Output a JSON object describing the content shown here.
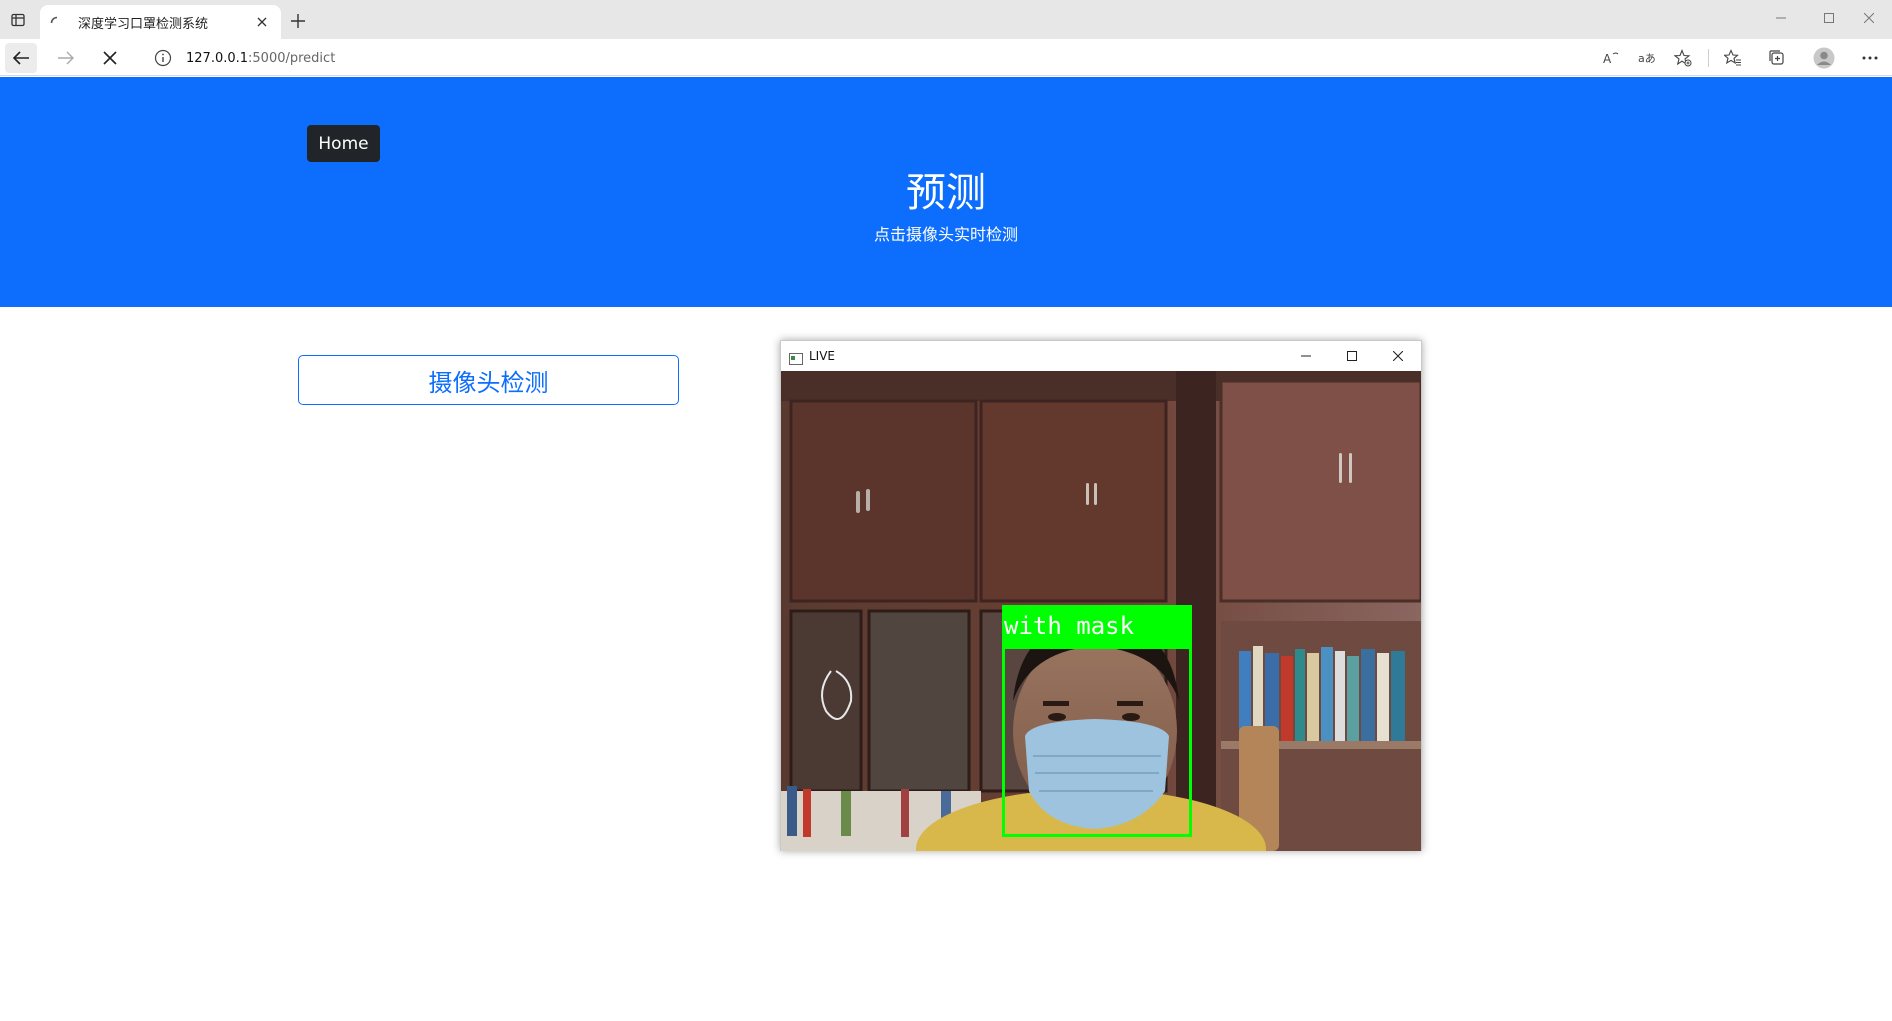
{
  "browser": {
    "tab_title": "深度学习口罩检测系统",
    "url_host": "127.0.0.1",
    "url_path": ":5000/predict"
  },
  "page": {
    "home_label": "Home",
    "title": "预测",
    "subtitle": "点击摄像头实时检测",
    "camera_button_label": "摄像头检测"
  },
  "live_window": {
    "title": "LIVE",
    "detection_label": "with mask"
  },
  "colors": {
    "hero": "#0d6efd",
    "home_button": "#212529",
    "detection": "#00ff00"
  }
}
